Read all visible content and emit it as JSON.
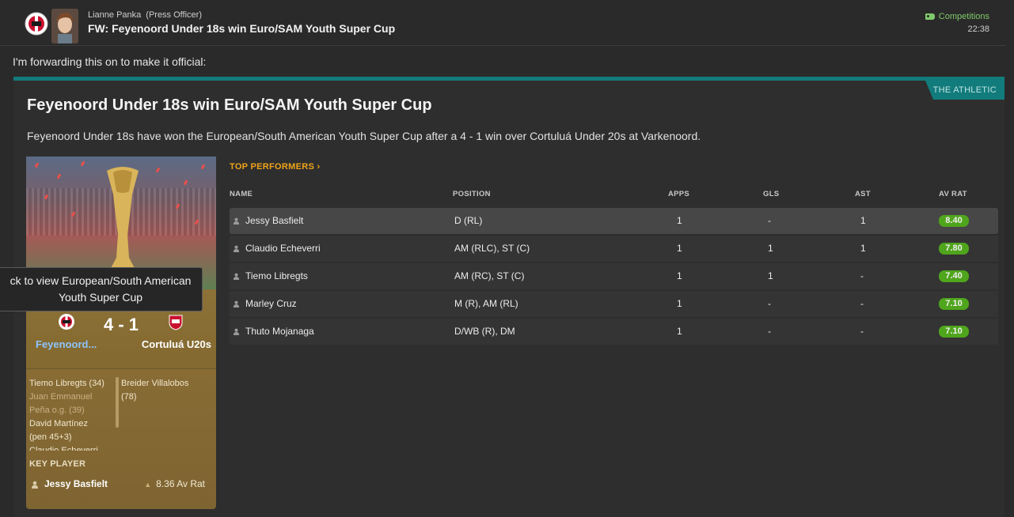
{
  "header": {
    "sender_name": "Lianne Panka",
    "sender_role": "(Press Officer)",
    "subject": "FW: Feyenoord Under 18s win Euro/SAM Youth Super Cup",
    "tag": "Competitions",
    "time": "22:38"
  },
  "intro": "I'm forwarding this on to make it official:",
  "article": {
    "source": "THE ATHLETIC",
    "title": "Feyenoord Under 18s win Euro/SAM Youth Super Cup",
    "body": "Feyenoord Under 18s have won the European/South American Youth Super Cup after a 4 - 1 win over Cortuluá Under 20s at Varkenoord."
  },
  "card": {
    "tooltip_line1": "ck to view European/South American",
    "tooltip_line2": "Youth Super Cup",
    "score": "4 - 1",
    "home_team": "Feyenoord...",
    "away_team": "Cortuluá U20s",
    "home_scorers": [
      {
        "text": "Tiemo Libregts (34)",
        "own_goal": false
      },
      {
        "text": "Juan Emmanuel",
        "own_goal": true
      },
      {
        "text": "Peña o.g. (39)",
        "own_goal": true
      },
      {
        "text": "David Martínez",
        "own_goal": false
      },
      {
        "text": "(pen 45+3)",
        "own_goal": false
      },
      {
        "text": "Claudio Echeverri",
        "own_goal": false
      }
    ],
    "away_scorers": [
      "Breider Villalobos",
      "(78)"
    ],
    "key_player_label": "KEY PLAYER",
    "key_player_name": "Jessy Basfielt",
    "key_player_rating": "8.36 Av Rat"
  },
  "performers": {
    "title": "TOP PERFORMERS",
    "columns": {
      "name": "NAME",
      "position": "POSITION",
      "apps": "APPS",
      "gls": "GLS",
      "ast": "AST",
      "rating": "AV RAT"
    },
    "rows": [
      {
        "name": "Jessy Basfielt",
        "position": "D (RL)",
        "apps": "1",
        "gls": "-",
        "ast": "1",
        "rating": "8.40"
      },
      {
        "name": "Claudio Echeverri",
        "position": "AM (RLC), ST (C)",
        "apps": "1",
        "gls": "1",
        "ast": "1",
        "rating": "7.80"
      },
      {
        "name": "Tiemo Libregts",
        "position": "AM (RC), ST (C)",
        "apps": "1",
        "gls": "1",
        "ast": "-",
        "rating": "7.40"
      },
      {
        "name": "Marley Cruz",
        "position": "M (R), AM (RL)",
        "apps": "1",
        "gls": "-",
        "ast": "-",
        "rating": "7.10"
      },
      {
        "name": "Thuto Mojanaga",
        "position": "D/WB (R), DM",
        "apps": "1",
        "gls": "-",
        "ast": "-",
        "rating": "7.10"
      }
    ]
  },
  "colors": {
    "accent_teal": "#127b7c",
    "link_orange": "#f0a31a",
    "rating_green": "#4fa51c",
    "tag_green": "#7fc96b"
  },
  "icons": {
    "club_badge": "feyenoord-badge-icon",
    "away_badge": "cortulua-badge-icon",
    "tag": "tag-icon",
    "player": "person-icon"
  }
}
